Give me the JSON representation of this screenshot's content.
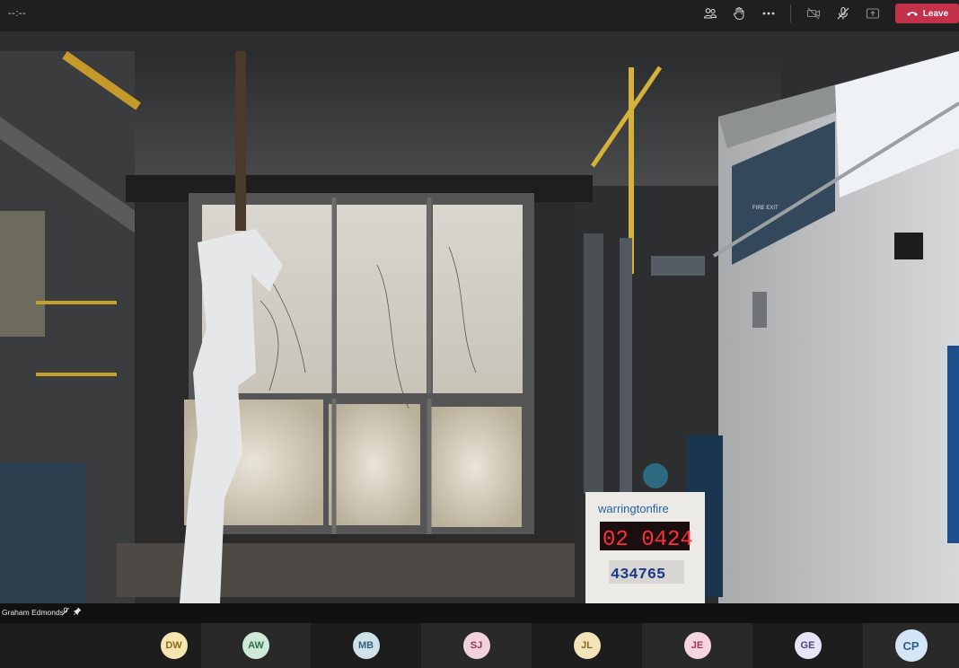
{
  "call": {
    "timer": "--:--",
    "controls": {
      "participants_icon": "people-icon",
      "raise_hand_icon": "raise-hand-icon",
      "more_icon": "more-icon",
      "camera_icon": "camera-off-icon",
      "mic_icon": "mic-off-icon",
      "share_icon": "share-icon",
      "leave_label": "Leave",
      "leave_icon": "phone-hangup-icon"
    },
    "colors": {
      "leave": "#c4314b",
      "topbar": "#201f1f",
      "strip": "#1e1d1d"
    }
  },
  "stage": {
    "speaker_name": "Graham Edmonds",
    "speaker_icons": [
      "mic-off-icon",
      "pin-icon"
    ],
    "sign_brand": "warringtonfire",
    "counter_red": "02 0424",
    "counter_blue": "434765",
    "wall_sign": "FIRE EXIT"
  },
  "participants": [
    {
      "initials": "DW",
      "color": "#f5e6b0",
      "text": "#8a6d1e"
    },
    {
      "initials": "AW",
      "color": "#cfe9d8",
      "text": "#2f6f4a"
    },
    {
      "initials": "MB",
      "color": "#cfe2e9",
      "text": "#34627a"
    },
    {
      "initials": "SJ",
      "color": "#f1d2dc",
      "text": "#8a3a55"
    },
    {
      "initials": "JL",
      "color": "#f3e3b8",
      "text": "#8a6a1e"
    },
    {
      "initials": "JE",
      "color": "#f5d5e0",
      "text": "#a3365f"
    },
    {
      "initials": "GE",
      "color": "#e6e4f5",
      "text": "#4a4880"
    },
    {
      "initials": "CP",
      "color": "#d4e6f5",
      "text": "#2f5f86"
    }
  ]
}
